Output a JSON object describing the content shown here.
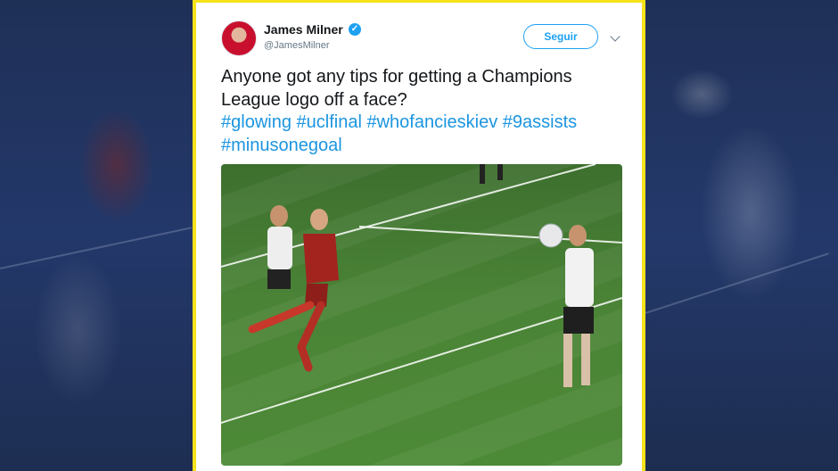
{
  "tweet": {
    "author_name": "James Milner",
    "author_handle": "@JamesMilner",
    "follow_label": "Seguir",
    "text_plain": "Anyone got any tips for getting a Champions League logo off a face?",
    "hashtags": [
      "#glowing",
      "#uclfinal",
      "#whofancieskiev",
      "#9assists",
      "#minusonegoal"
    ],
    "verified_icon": "verified-badge-icon",
    "media_description_icon": "photo"
  },
  "colors": {
    "frame": "#f6e21a",
    "link": "#1b95e0",
    "follow": "#1da1f2",
    "text": "#14171a",
    "muted": "#657786"
  }
}
